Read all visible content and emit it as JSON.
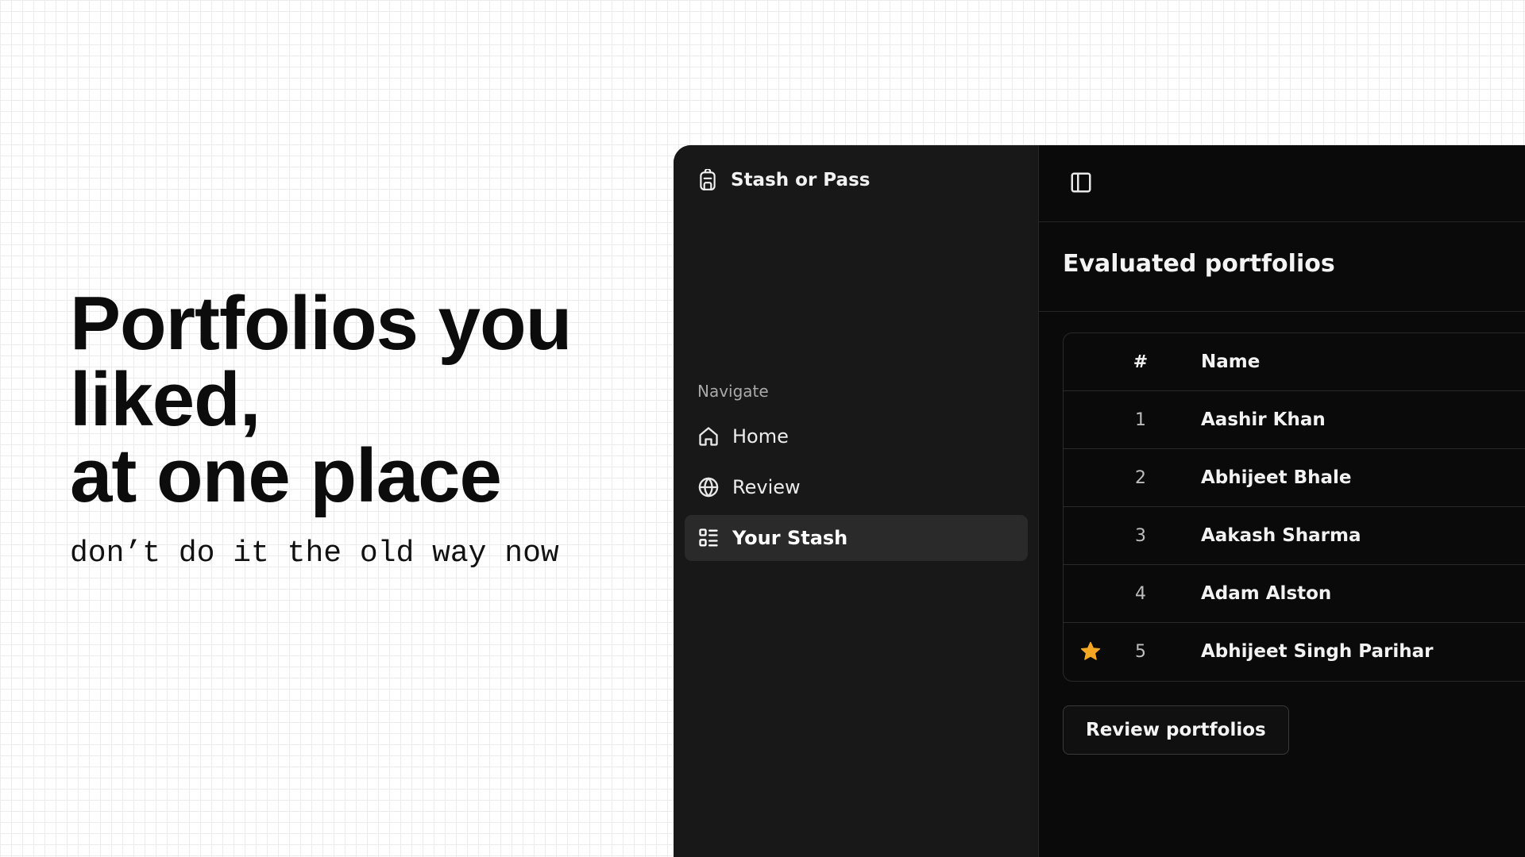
{
  "hero": {
    "title_lines": [
      "Portfolios you",
      "liked,",
      "at one place"
    ],
    "subtitle": "don’t do it the old way now"
  },
  "app": {
    "name": "Stash or Pass",
    "brand_icon": "backpack-icon",
    "nav_label": "Navigate",
    "nav": [
      {
        "label": "Home",
        "icon": "home-icon",
        "active": false
      },
      {
        "label": "Review",
        "icon": "globe-icon",
        "active": false
      },
      {
        "label": "Your Stash",
        "icon": "list-icon",
        "active": true
      }
    ],
    "sidebar_toggle_icon": "sidebar-toggle-icon"
  },
  "main": {
    "title": "Evaluated portfolios",
    "table": {
      "headers": [
        "#",
        "Name"
      ],
      "rows": [
        {
          "num": "1",
          "name": "Aashir Khan",
          "starred": false
        },
        {
          "num": "2",
          "name": "Abhijeet Bhale",
          "starred": false
        },
        {
          "num": "3",
          "name": "Aakash Sharma",
          "starred": false
        },
        {
          "num": "4",
          "name": "Adam Alston",
          "starred": false
        },
        {
          "num": "5",
          "name": "Abhijeet Singh Parihar",
          "starred": true
        }
      ]
    },
    "review_button": "Review portfolios"
  },
  "colors": {
    "star": "#f5a623",
    "sidebar_bg": "#181818",
    "main_bg": "#0a0a0a",
    "active_nav_bg": "#2a2a2a"
  }
}
